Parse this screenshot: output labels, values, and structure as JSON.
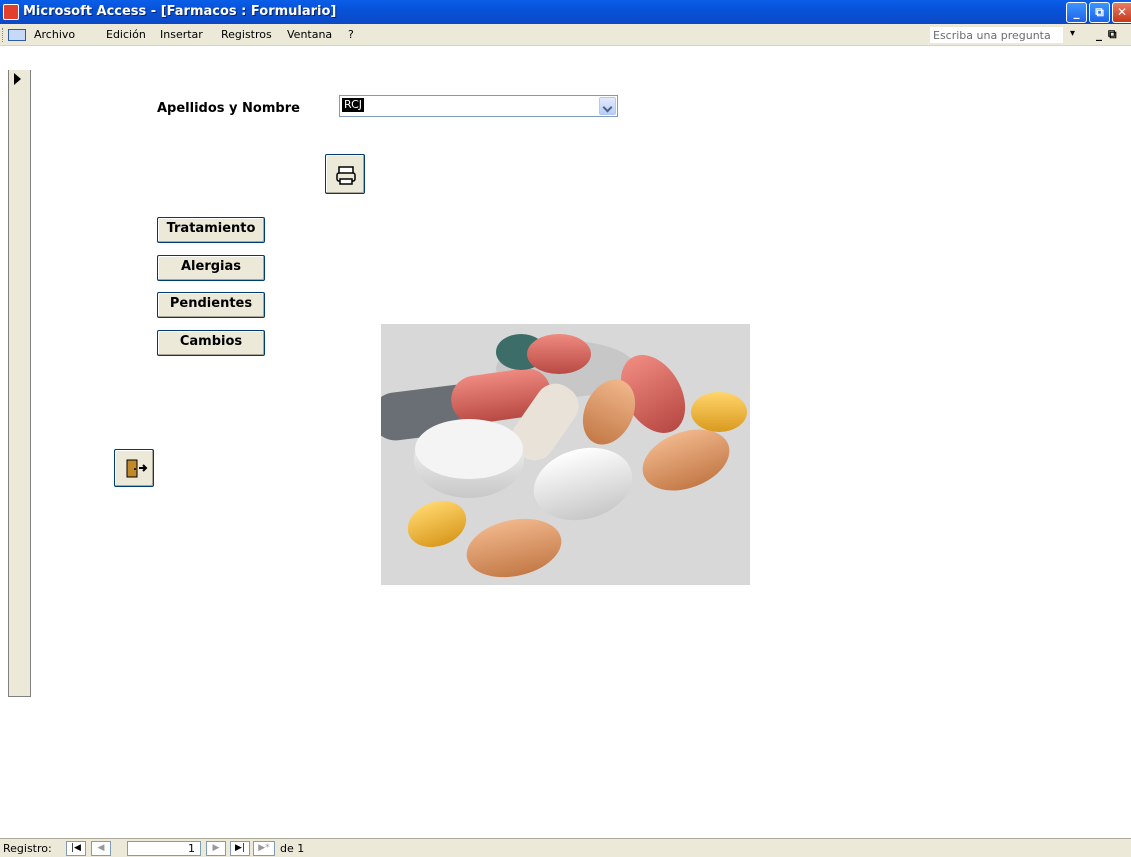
{
  "window": {
    "title": "Microsoft Access - [Farmacos : Formulario]",
    "controls": [
      "_",
      "⧉",
      "✕"
    ]
  },
  "menu": {
    "items": [
      "Archivo",
      "Edición",
      "Insertar",
      "Registros",
      "Ventana",
      "?"
    ],
    "ask_placeholder": "Escriba una pregunta"
  },
  "form": {
    "name_label": "Apellidos y Nombre",
    "name_value": "RCJ",
    "buttons": [
      "Tratamiento",
      "Alergias",
      "Pendientes",
      "Cambios"
    ]
  },
  "status": {
    "record_label": "Registro:",
    "record_current": "1",
    "record_total": "de 1"
  },
  "colors": {
    "titlebar": "#0a5ee8",
    "chrome": "#ece9d8"
  }
}
